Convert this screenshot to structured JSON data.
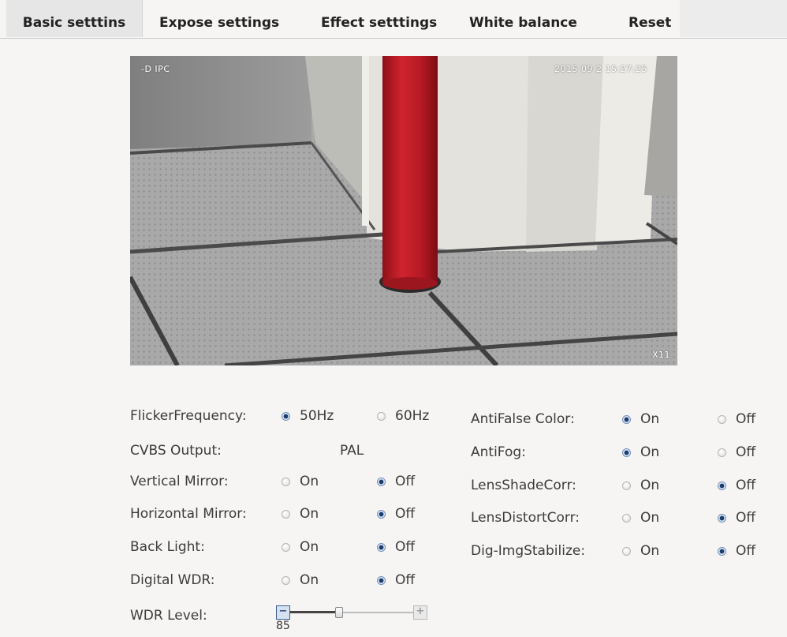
{
  "tabs": [
    {
      "label": "Basic setttins",
      "active": true
    },
    {
      "label": "Expose settings",
      "active": false
    },
    {
      "label": "Effect setttings",
      "active": false
    },
    {
      "label": "White balance",
      "active": false
    },
    {
      "label": "Reset",
      "active": false
    }
  ],
  "video": {
    "osd_left": "-D IPC",
    "osd_time": "2015 09 2  15:27:25",
    "osd_zoom": "X11"
  },
  "settings": {
    "flicker": {
      "label": "FlickerFrequency:",
      "opt1": "50Hz",
      "opt2": "60Hz",
      "selected": "50Hz"
    },
    "cvbs": {
      "label": "CVBS Output:",
      "value": "PAL"
    },
    "vertical_mirror": {
      "label": "Vertical Mirror:",
      "on": "On",
      "off": "Off",
      "selected": "Off"
    },
    "horizontal_mirror": {
      "label": "Horizontal Mirror:",
      "on": "On",
      "off": "Off",
      "selected": "Off"
    },
    "back_light": {
      "label": "Back Light:",
      "on": "On",
      "off": "Off",
      "selected": "Off"
    },
    "digital_wdr": {
      "label": "Digital WDR:",
      "on": "On",
      "off": "Off",
      "selected": "Off"
    },
    "wdr_level": {
      "label": "WDR Level:",
      "value": "85",
      "fraction": 0.4
    },
    "anti_false_color": {
      "label": "AntiFalse Color:",
      "on": "On",
      "off": "Off",
      "selected": "On"
    },
    "anti_fog": {
      "label": "AntiFog:",
      "on": "On",
      "off": "Off",
      "selected": "On"
    },
    "lens_shade_corr": {
      "label": "LensShadeCorr:",
      "on": "On",
      "off": "Off",
      "selected": "Off"
    },
    "lens_distort_corr": {
      "label": "LensDistortCorr:",
      "on": "On",
      "off": "Off",
      "selected": "Off"
    },
    "dig_img_stabilize": {
      "label": "Dig-ImgStabilize:",
      "on": "On",
      "off": "Off",
      "selected": "Off"
    }
  },
  "colors": {
    "accent": "#1d3c6e",
    "pipe": "#c41e2a",
    "active_tab": "#e6e6e6"
  }
}
